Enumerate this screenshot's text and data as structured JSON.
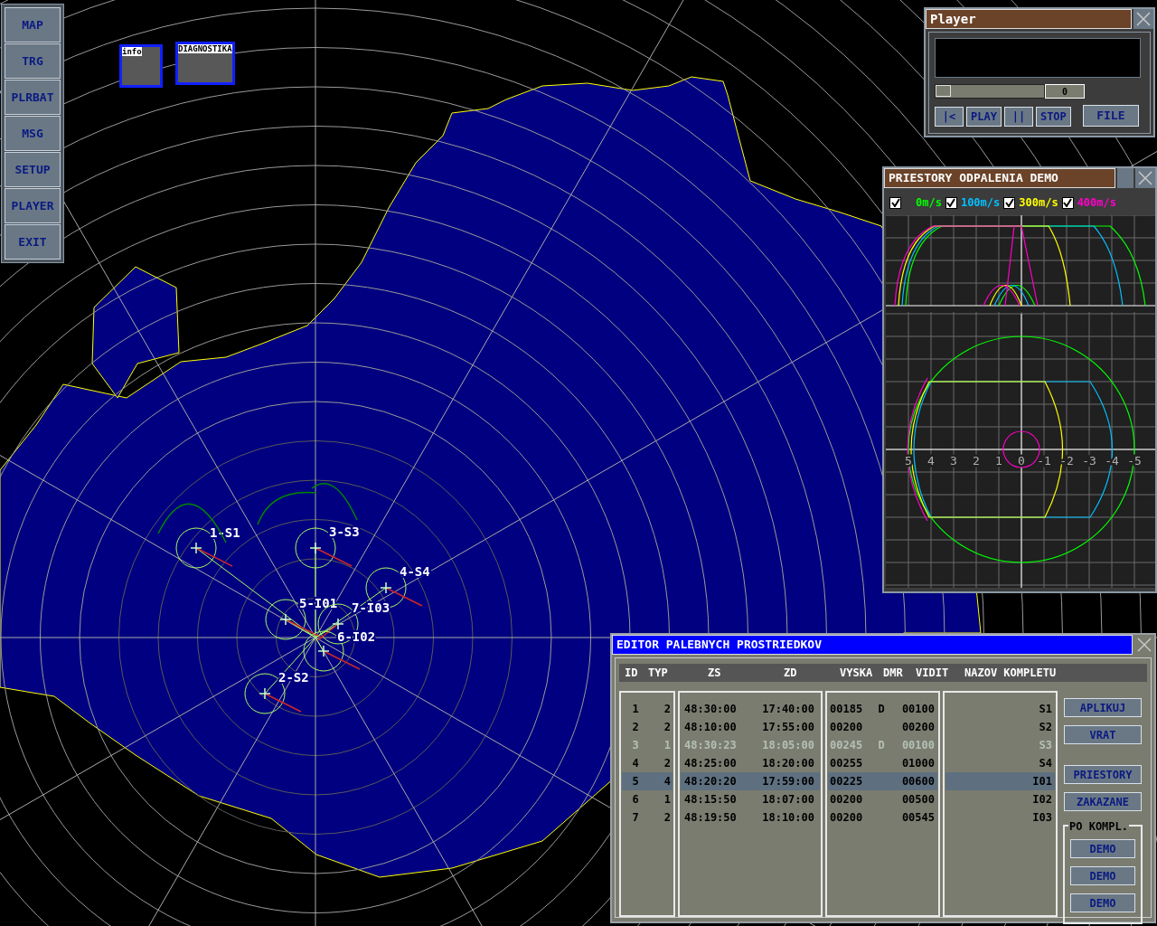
{
  "menu": [
    {
      "label": "MAP"
    },
    {
      "label": "TRG"
    },
    {
      "label": "PLRBAT"
    },
    {
      "label": "MSG"
    },
    {
      "label": "SETUP"
    },
    {
      "label": "PLAYER"
    },
    {
      "label": "EXIT"
    }
  ],
  "mini_panels": [
    {
      "title": "info"
    },
    {
      "title": "DIAGNOSTIKA"
    }
  ],
  "targets": [
    {
      "label": "1-S1"
    },
    {
      "label": "3-S3"
    },
    {
      "label": "4-S4"
    },
    {
      "label": "5-I01"
    },
    {
      "label": "7-I03"
    },
    {
      "label": "6-I02"
    },
    {
      "label": "2-S2"
    }
  ],
  "player": {
    "title": "Player",
    "position": {
      "level": 0.0
    },
    "counter": "0",
    "buttons": [
      "|<",
      "PLAY",
      "||",
      "STOP"
    ],
    "file_button": "FILE"
  },
  "priestory": {
    "title": "PRIESTORY ODPALENIA DEMO",
    "speeds": [
      {
        "label": "0m/s",
        "checked": true,
        "color": "#00ff00"
      },
      {
        "label": "100m/s",
        "checked": true,
        "color": "#00c0ff"
      },
      {
        "label": "300m/s",
        "checked": true,
        "color": "#ffff00"
      },
      {
        "label": "400m/s",
        "checked": true,
        "color": "#ff00c8"
      }
    ],
    "axis_labels": [
      "5",
      "4",
      "3",
      "2",
      "1",
      "0",
      "-1",
      "-2",
      "-3",
      "-4",
      "-5"
    ]
  },
  "editor": {
    "title": "EDITOR PALEBNYCH PROSTRIEDKOV",
    "columns": [
      "ID",
      "TYP",
      "ZS",
      "ZD",
      "VYSKA",
      "DMR",
      "VIDIT",
      "NAZOV KOMPLETU"
    ],
    "rows": [
      {
        "id": "1",
        "typ": "2",
        "zs": "48:30:00",
        "zd": "17:40:00",
        "vyska": "00185",
        "dmr": "D",
        "vidit": "00100",
        "nazov": "S1",
        "selected": false,
        "disabled": false
      },
      {
        "id": "2",
        "typ": "2",
        "zs": "48:10:00",
        "zd": "17:55:00",
        "vyska": "00200",
        "vidit": "00200",
        "nazov": "S2",
        "selected": false,
        "disabled": false
      },
      {
        "id": "3",
        "typ": "1",
        "zs": "48:30:23",
        "zd": "18:05:00",
        "vyska": "00245",
        "dmr": "D",
        "vidit": "00100",
        "nazov": "S3",
        "selected": false,
        "disabled": true
      },
      {
        "id": "4",
        "typ": "2",
        "zs": "48:25:00",
        "zd": "18:20:00",
        "vyska": "00255",
        "vidit": "01000",
        "nazov": "S4",
        "selected": false,
        "disabled": false
      },
      {
        "id": "5",
        "typ": "4",
        "zs": "48:20:20",
        "zd": "17:59:00",
        "vyska": "00225",
        "vidit": "00600",
        "nazov": "I01",
        "selected": true,
        "disabled": false
      },
      {
        "id": "6",
        "typ": "1",
        "zs": "48:15:50",
        "zd": "18:07:00",
        "vyska": "00200",
        "vidit": "00500",
        "nazov": "I02",
        "selected": false,
        "disabled": false
      },
      {
        "id": "7",
        "typ": "2",
        "zs": "48:19:50",
        "zd": "18:10:00",
        "vyska": "00200",
        "vidit": "00545",
        "nazov": "I03",
        "selected": false,
        "disabled": false
      }
    ],
    "buttons": [
      "APLIKUJ",
      "VRAT"
    ],
    "buttons_2": [
      "PRIESTORY",
      "ZAKAZANE"
    ],
    "group": {
      "title": "PO KOMPL.",
      "buttons": [
        "DEMO",
        "DEMO",
        "DEMO"
      ]
    }
  }
}
